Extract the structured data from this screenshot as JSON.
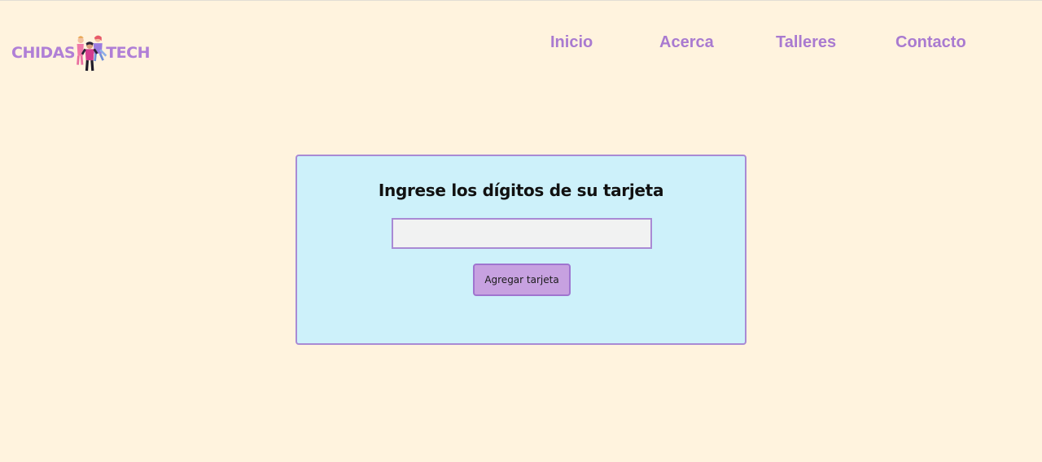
{
  "brand": {
    "left_text": "CHIDAS",
    "right_text": "TECH",
    "logo_icon": "people-illustration-icon",
    "color": "#b07fd6"
  },
  "nav": {
    "items": [
      {
        "label": "Inicio"
      },
      {
        "label": "Acerca"
      },
      {
        "label": "Talleres"
      },
      {
        "label": "Contacto"
      }
    ],
    "color": "#a97ad0"
  },
  "card": {
    "title": "Ingrese los dígitos de su tarjeta",
    "input_value": "",
    "input_placeholder": "",
    "button_label": "Agregar tarjeta",
    "background": "#cdf1fa",
    "border_color": "#a98ad4"
  },
  "colors": {
    "page_background": "#fff3de",
    "button_background": "#c7a1e0"
  }
}
